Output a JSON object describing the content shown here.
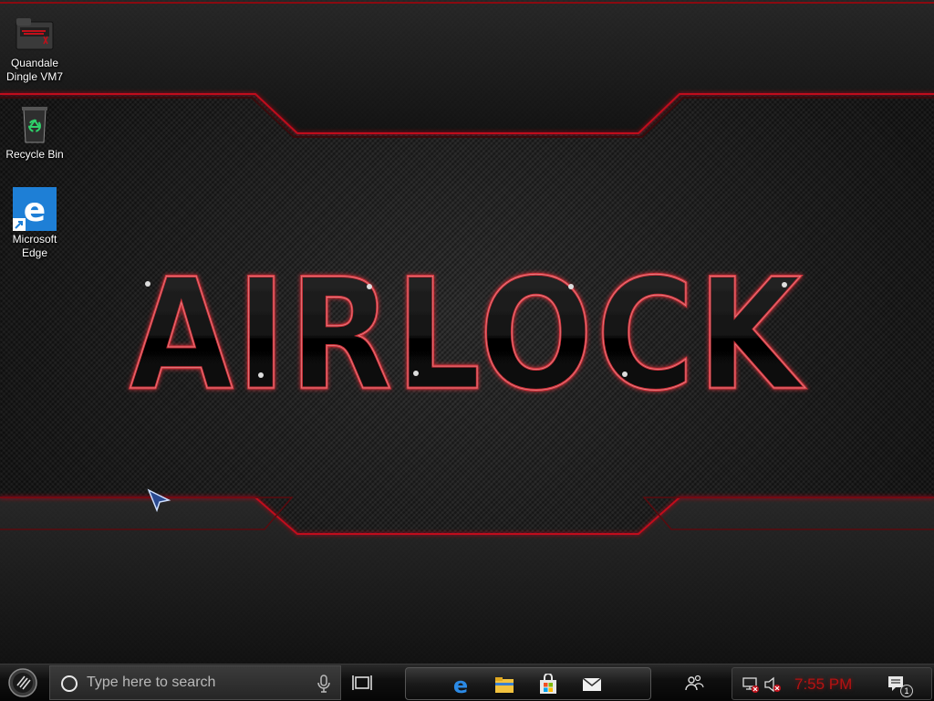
{
  "desktop": {
    "icons": [
      {
        "label": "Quandale Dingle VM7",
        "icon": "folder-icon"
      },
      {
        "label": "Recycle Bin",
        "icon": "recycle-bin-icon"
      },
      {
        "label": "Microsoft Edge",
        "icon": "edge-icon"
      }
    ],
    "wallpaper": {
      "logo_text": "AIRLOCK",
      "colors": {
        "accent": "#c0101a",
        "base": "#1c1c1c"
      }
    }
  },
  "taskbar": {
    "start_icon": "start-orb-icon",
    "search": {
      "placeholder": "Type here to search",
      "icon": "cortana-circle-icon",
      "mic_icon": "microphone-icon"
    },
    "task_view_icon": "task-view-icon",
    "pinned_apps": [
      {
        "name": "Microsoft Edge",
        "icon": "edge-icon"
      },
      {
        "name": "File Explorer",
        "icon": "folder-icon"
      },
      {
        "name": "Microsoft Store",
        "icon": "store-bag-icon"
      },
      {
        "name": "Mail",
        "icon": "mail-icon"
      }
    ],
    "tray": {
      "people_icon": "people-icon",
      "network_icon": "network-disconnected-icon",
      "volume_icon": "volume-muted-icon",
      "clock": "7:55 PM",
      "notifications_icon": "notification-icon",
      "notification_count": "1"
    }
  }
}
